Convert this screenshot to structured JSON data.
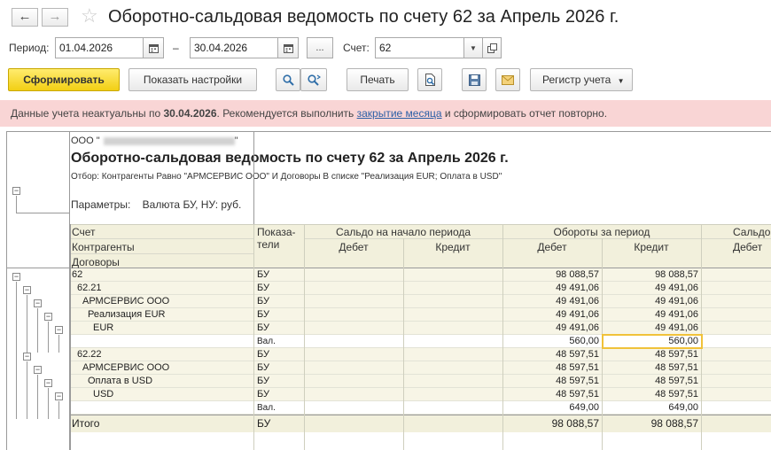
{
  "window": {
    "title": "Оборотно-сальдовая ведомость по счету 62 за Апрель 2026 г.",
    "back_symbol": "←",
    "forward_symbol": "→",
    "favorite_symbol": "☆"
  },
  "filters": {
    "period_label": "Период:",
    "date_from": "01.04.2026",
    "dash": "–",
    "date_to": "30.04.2026",
    "more_label": "...",
    "account_label": "Счет:",
    "account_value": "62"
  },
  "toolbar": {
    "generate_label": "Сформировать",
    "settings_label": "Показать настройки",
    "print_label": "Печать",
    "register_label": "Регистр учета"
  },
  "warning": {
    "prefix": "Данные учета неактуальны по ",
    "date": "30.04.2026",
    "middle": ". Рекомендуется выполнить ",
    "link": "закрытие месяца",
    "suffix": " и сформировать отчет повторно."
  },
  "report": {
    "org_prefix": "ООО \"",
    "org_suffix": "\"",
    "title": "Оборотно-сальдовая ведомость по счету 62 за Апрель 2026 г.",
    "filter_text": "Отбор: Контрагенты Равно \"АРМСЕРВИС ООО\" И Договоры В списке \"Реализация EUR; Оплата в USD\"",
    "params_label": "Параметры:",
    "params_value": "Валюта БУ, НУ: руб.",
    "header": {
      "col_account": "Счет",
      "col_counterparties": "Контрагенты",
      "col_contracts": "Договоры",
      "col_indicators_1": "Показа-",
      "col_indicators_2": "тели",
      "opening_balance": "Сальдо на начало периода",
      "turnover": "Обороты за период",
      "closing_balance": "Сальдо",
      "debit": "Дебет",
      "credit": "Кредит"
    },
    "rows": [
      {
        "name": "62",
        "ind": "БУ",
        "turn_debit": "98 088,57",
        "turn_credit": "98 088,57"
      },
      {
        "name": "62.21",
        "ind": "БУ",
        "turn_debit": "49 491,06",
        "turn_credit": "49 491,06"
      },
      {
        "name": "АРМСЕРВИС ООО",
        "ind": "БУ",
        "turn_debit": "49 491,06",
        "turn_credit": "49 491,06"
      },
      {
        "name": "Реализация EUR",
        "ind": "БУ",
        "turn_debit": "49 491,06",
        "turn_credit": "49 491,06"
      },
      {
        "name": "EUR",
        "ind": "БУ",
        "turn_debit": "49 491,06",
        "turn_credit": "49 491,06"
      },
      {
        "name": "",
        "ind": "Вал.",
        "turn_debit": "560,00",
        "turn_credit": "560,00"
      },
      {
        "name": "62.22",
        "ind": "БУ",
        "turn_debit": "48 597,51",
        "turn_credit": "48 597,51"
      },
      {
        "name": "АРМСЕРВИС ООО",
        "ind": "БУ",
        "turn_debit": "48 597,51",
        "turn_credit": "48 597,51"
      },
      {
        "name": "Оплата в USD",
        "ind": "БУ",
        "turn_debit": "48 597,51",
        "turn_credit": "48 597,51"
      },
      {
        "name": "USD",
        "ind": "БУ",
        "turn_debit": "48 597,51",
        "turn_credit": "48 597,51"
      },
      {
        "name": "",
        "ind": "Вал.",
        "turn_debit": "649,00",
        "turn_credit": "649,00"
      }
    ],
    "total": {
      "name": "Итого",
      "ind": "БУ",
      "turn_debit": "98 088,57",
      "turn_credit": "98 088,57"
    }
  }
}
